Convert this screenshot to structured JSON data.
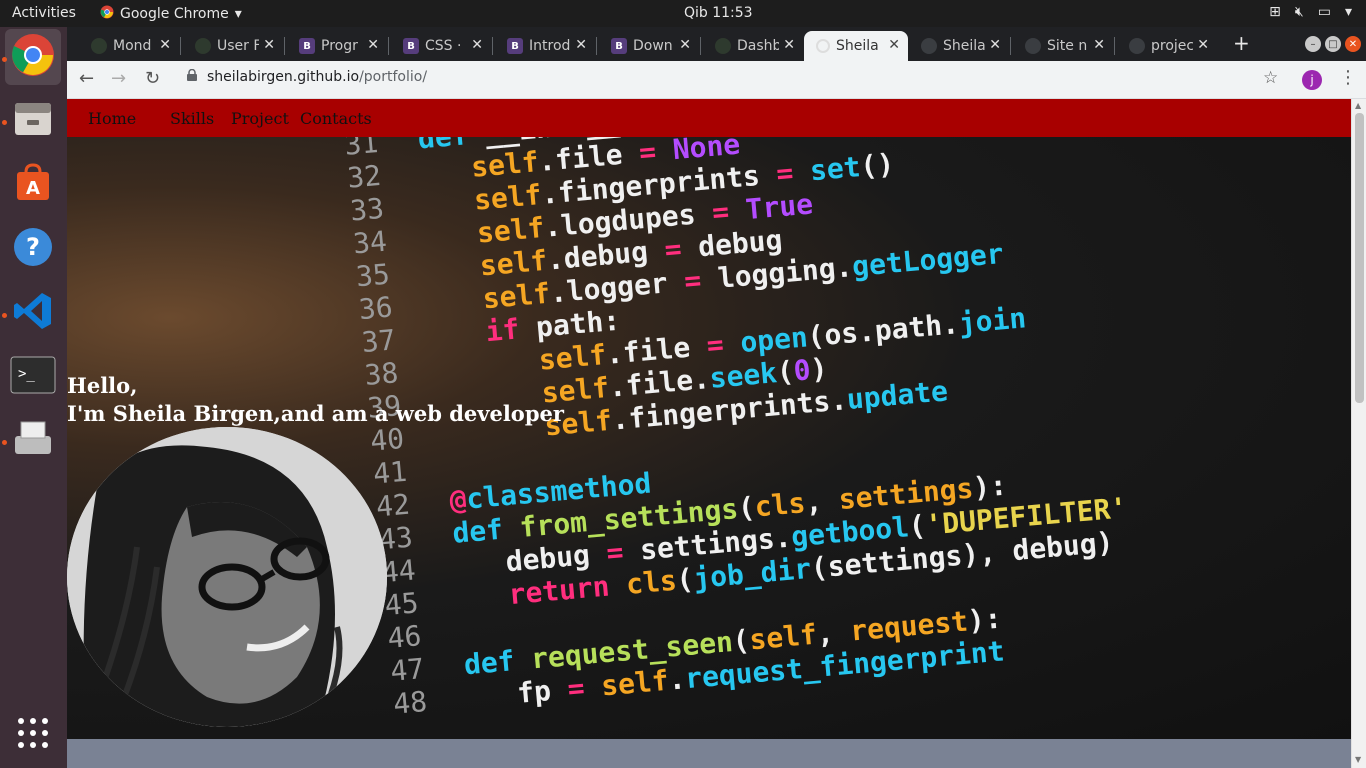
{
  "topbar": {
    "activities": "Activities",
    "app_name": "Google Chrome",
    "clock": "Qib 11:53"
  },
  "dock": {
    "items": [
      "chrome-icon",
      "file-manager-icon",
      "software-store-icon",
      "help-icon",
      "vscode-icon",
      "terminal-icon",
      "scanner-icon",
      "app-grid-icon"
    ]
  },
  "tabs": [
    {
      "title": "Mond",
      "favicon": "github-icon"
    },
    {
      "title": "User F",
      "favicon": "github-icon"
    },
    {
      "title": "Progr",
      "favicon": "bootstrap-icon"
    },
    {
      "title": "CSS · B",
      "favicon": "bootstrap-icon"
    },
    {
      "title": "Introd",
      "favicon": "bootstrap-icon"
    },
    {
      "title": "Down",
      "favicon": "bootstrap-icon"
    },
    {
      "title": "Dashb",
      "favicon": "github-icon"
    },
    {
      "title": "Sheila",
      "favicon": "globe-icon",
      "active": true
    },
    {
      "title": "Sheila",
      "favicon": "github-icon"
    },
    {
      "title": "Site n",
      "favicon": "github-icon"
    },
    {
      "title": "projec",
      "favicon": "github-icon"
    }
  ],
  "toolbar": {
    "url_host": "sheilabirgen.github.io",
    "url_path": "/portfolio/",
    "avatar_letter": "j"
  },
  "page": {
    "nav": {
      "home": "Home",
      "skills": "Skills",
      "project": "Project",
      "contacts": "Contacts"
    },
    "greeting_line1": "Hello,",
    "greeting_line2": "I'm Sheila Birgen,and am a web developer"
  },
  "colors": {
    "navbar_bg": "#a80000",
    "footer_bg": "#7a8294",
    "dock_bg": "#3d2e37"
  },
  "code_background": {
    "line_numbers": [
      "31",
      "32",
      "33",
      "34",
      "35",
      "36",
      "37",
      "38",
      "39",
      "40",
      "41",
      "42",
      "43",
      "44",
      "45",
      "46",
      "47",
      "48"
    ]
  }
}
